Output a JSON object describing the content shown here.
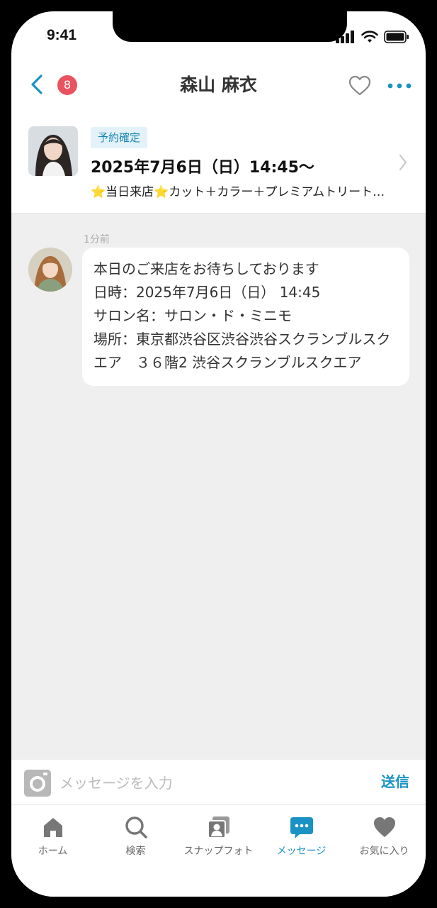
{
  "status_bar": {
    "time": "9:41"
  },
  "header": {
    "unread_count": "8",
    "title": "森山 麻衣"
  },
  "booking": {
    "status": "予約確定",
    "date": "2025年7月6日（日）14:45〜",
    "menu": "⭐当日来店⭐カット＋カラー＋プレミアムトリートメント"
  },
  "chat": {
    "messages": [
      {
        "time": "1分前",
        "text": "本日のご来店をお待ちしております\n日時：2025年7月6日（日） 14:45\nサロン名：サロン・ド・ミニモ\n場所：東京都渋谷区渋谷渋谷スクランブルスクエア　３６階2 渋谷スクランブルスクエア"
      }
    ]
  },
  "composer": {
    "placeholder": "メッセージを入力",
    "send_label": "送信"
  },
  "tabs": [
    {
      "label": "ホーム",
      "icon": "home-icon"
    },
    {
      "label": "検索",
      "icon": "search-icon"
    },
    {
      "label": "スナップフォト",
      "icon": "photos-icon"
    },
    {
      "label": "メッセージ",
      "icon": "message-icon",
      "active": true
    },
    {
      "label": "お気に入り",
      "icon": "heart-icon"
    }
  ],
  "colors": {
    "accent": "#1a93c4",
    "badge": "#e9525e",
    "chat_bg": "#efefef",
    "tag_bg": "#e3f2f9"
  }
}
